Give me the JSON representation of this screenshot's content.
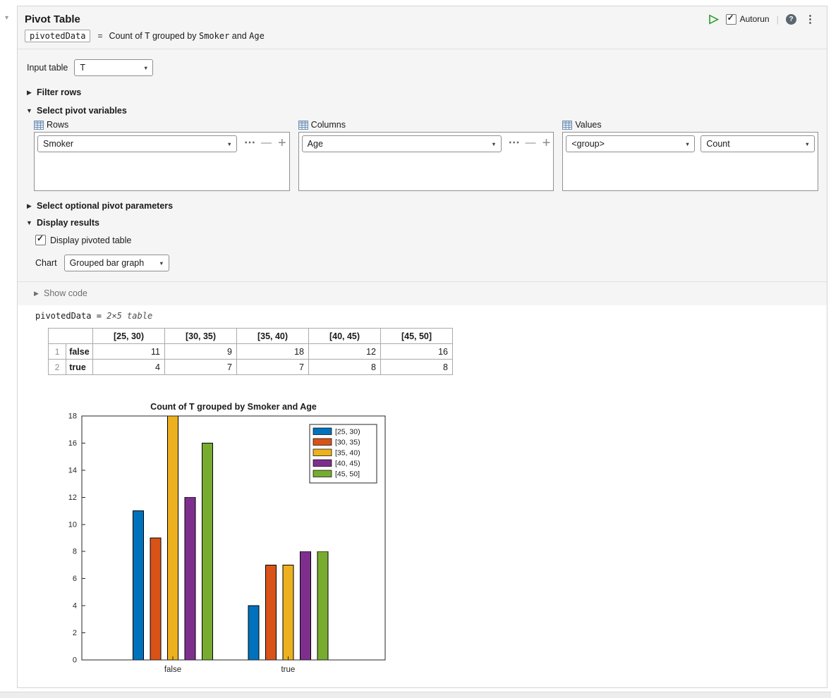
{
  "colors": {
    "run_button": "#2e9c2e",
    "panel_border": "#d4d4d4",
    "panel_background": "#f5f5f5"
  },
  "icons": {
    "run": "▷",
    "dropdown_arrow": "▼",
    "collapsed_arrow": "▶",
    "expanded_arrow": "▼",
    "section_marker": "▾",
    "ellipsis": "⋯",
    "minus": "—",
    "plus": "+",
    "menu_dots": "⋮",
    "help": "?",
    "check": "✓",
    "separator": "|"
  },
  "header": {
    "title": "Pivot Table",
    "autorun_label": "Autorun",
    "output_variable": "pivotedData",
    "equals": "=",
    "signature_parts": [
      {
        "t": "Count of ",
        "mono": false
      },
      {
        "t": "T",
        "mono": true
      },
      {
        "t": " grouped by ",
        "mono": false
      },
      {
        "t": "Smoker",
        "mono": true
      },
      {
        "t": " and ",
        "mono": false
      },
      {
        "t": "Age",
        "mono": true
      }
    ]
  },
  "body": {
    "input_table": {
      "label": "Input table",
      "value": "T"
    },
    "sections": {
      "filter_rows": "Filter rows",
      "select_pivot_variables": "Select pivot variables",
      "optional_parameters": "Select optional pivot parameters",
      "display_results": "Display results",
      "show_code": "Show code"
    },
    "pivot": {
      "rows_label": "Rows",
      "rows_value": "Smoker",
      "columns_label": "Columns",
      "columns_value": "Age",
      "values_label": "Values",
      "values_group": "<group>",
      "values_stat": "Count"
    },
    "display": {
      "pivoted_table_checkbox": "Display pivoted table",
      "chart_label": "Chart",
      "chart_value": "Grouped bar graph"
    }
  },
  "output": {
    "result_lhs": "pivotedData = ",
    "result_rhs": "2×5 table",
    "table": {
      "columns": [
        "[25, 30)",
        "[30, 35)",
        "[35, 40)",
        "[40, 45)",
        "[45, 50]"
      ],
      "rows": [
        {
          "num": "1",
          "name": "false",
          "values": [
            "11",
            "9",
            "18",
            "12",
            "16"
          ]
        },
        {
          "num": "2",
          "name": "true",
          "values": [
            "4",
            "7",
            "7",
            "8",
            "8"
          ]
        }
      ]
    }
  },
  "chart_data": {
    "type": "bar",
    "title": "Count of T grouped by Smoker and Age",
    "categories": [
      "false",
      "true"
    ],
    "series": [
      {
        "name": "[25, 30)",
        "values": [
          11,
          4
        ],
        "color": "#0072BD"
      },
      {
        "name": "[30, 35)",
        "values": [
          9,
          7
        ],
        "color": "#D95319"
      },
      {
        "name": "[35, 40)",
        "values": [
          18,
          7
        ],
        "color": "#EDB120"
      },
      {
        "name": "[40, 45)",
        "values": [
          12,
          8
        ],
        "color": "#7E2F8E"
      },
      {
        "name": "[45, 50]",
        "values": [
          16,
          8
        ],
        "color": "#77AC30"
      }
    ],
    "xlabel": "",
    "ylabel": "",
    "ylim": [
      0,
      18
    ],
    "ytick_step": 2,
    "legend_position": "northeast",
    "grid": false
  }
}
